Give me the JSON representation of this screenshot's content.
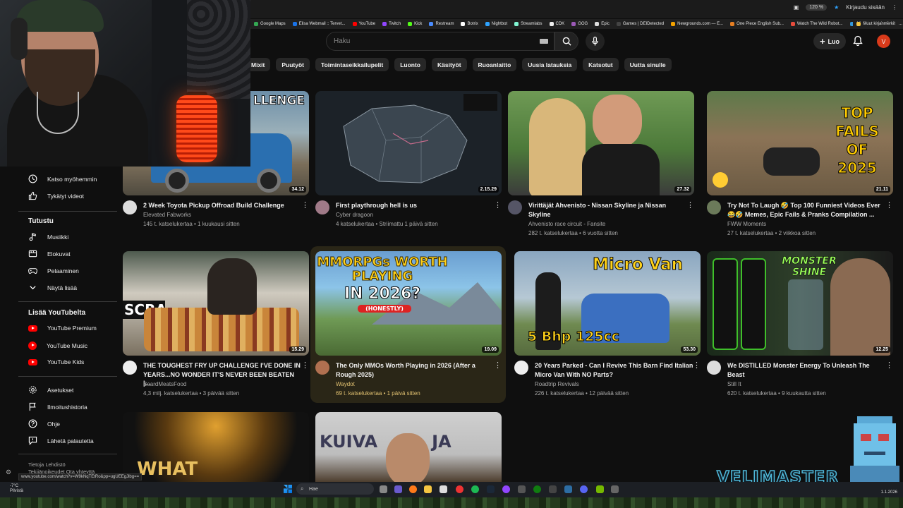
{
  "browser": {
    "zoom": "120 %",
    "profile_label": "Kirjaudu sisään",
    "bookmarks": [
      {
        "label": "Google Maps",
        "color": "#34a853"
      },
      {
        "label": "Elisa Webmail :: Tervet...",
        "color": "#1a73e8"
      },
      {
        "label": "YouTube",
        "color": "#ff0000"
      },
      {
        "label": "Twitch",
        "color": "#9146ff"
      },
      {
        "label": "Kick",
        "color": "#53fc18"
      },
      {
        "label": "Restream",
        "color": "#4a8cff"
      },
      {
        "label": "Botrix",
        "color": "#ffffff"
      },
      {
        "label": "Nightbot",
        "color": "#2ea3ff"
      },
      {
        "label": "Streamlabs",
        "color": "#80f5d2"
      },
      {
        "label": "CDK",
        "color": "#eeeeee"
      },
      {
        "label": "GOG",
        "color": "#9b59b6"
      },
      {
        "label": "Epic",
        "color": "#dddddd"
      },
      {
        "label": "Games | DEIDetected",
        "color": "#444444"
      },
      {
        "label": "Newgrounds.com — E...",
        "color": "#f4a200"
      },
      {
        "label": "One Piece English Sub...",
        "color": "#e67e22"
      },
      {
        "label": "Watch The Wild Robot...",
        "color": "#e74c3c"
      },
      {
        "label": "Aikuisten sosiaalipalve...",
        "color": "#3498db"
      }
    ],
    "more_bookmarks": "Muut kirjanmerkit",
    "status_url": "www.youtube.com/watch?v=W9kNqTEtRo&pp=ugUEEgJlbg=="
  },
  "header": {
    "search_placeholder": "Haku",
    "create_label": "Luo",
    "avatar_letter": "V"
  },
  "chips": [
    "Mixit",
    "Puutyöt",
    "Toimintaseikkailupelit",
    "Luonto",
    "Käsityöt",
    "Ruoanlaitto",
    "Uusia latauksia",
    "Katsotut",
    "Uutta sinulle"
  ],
  "sidebar": {
    "items_top": [
      {
        "label": "Katso myöhemmin",
        "icon": "clock-icon"
      },
      {
        "label": "Tykätyt videot",
        "icon": "thumb-up-icon"
      }
    ],
    "explore_heading": "Tutustu",
    "explore": [
      {
        "label": "Musiikki",
        "icon": "music-note-icon"
      },
      {
        "label": "Elokuvat",
        "icon": "clapperboard-icon"
      },
      {
        "label": "Pelaaminen",
        "icon": "gamepad-icon"
      },
      {
        "label": "Näytä lisää",
        "icon": "chevron-down-icon"
      }
    ],
    "more_heading": "Lisää YouTubelta",
    "more": [
      {
        "label": "YouTube Premium"
      },
      {
        "label": "YouTube Music"
      },
      {
        "label": "YouTube Kids"
      }
    ],
    "settings": [
      {
        "label": "Asetukset",
        "icon": "gear-icon"
      },
      {
        "label": "Ilmoitushistoria",
        "icon": "flag-icon"
      },
      {
        "label": "Ohje",
        "icon": "help-icon"
      },
      {
        "label": "Lähetä palautetta",
        "icon": "feedback-icon"
      }
    ],
    "footer_line1": "Tietoja   Lehdistö",
    "footer_line2": "Tekijänoikeudet   Ota yhteyttä"
  },
  "videos": [
    {
      "title": "2 Week Toyota Pickup Offroad Build Challenge",
      "channel": "Elevated Fabworks",
      "meta": "145 t. katselukertaa • 1 kuukausi sitten",
      "duration": "34.12",
      "overlay": "LLENGE"
    },
    {
      "title": "First playthrough hell is us",
      "channel": "Cyber dragoon",
      "meta": "4 katselukertaa • Striimattu 1 päivä sitten",
      "duration": "2.15.29"
    },
    {
      "title": "Virittäjät Ahvenisto - Nissan Skyline ja Nissan Skyline",
      "channel": "Ahvenisto race circuit - Fansite",
      "meta": "282 t. katselukertaa • 6 vuotta sitten",
      "duration": "27.32"
    },
    {
      "title": "Try Not To Laugh 🤣 Top 100 Funniest Videos Ever 😂🤣 Memes, Epic Fails & Pranks Compilation ...",
      "channel": "FWW Moments",
      "meta": "27 t. katselukertaa • 2 viikkoa sitten",
      "duration": "21.11",
      "overlay": "TOP FAILS OF 2025"
    },
    {
      "title": "THE TOUGHEST FRY UP CHALLENGE I'VE DONE IN YEARS...NO WONDER IT'S NEVER BEEN BEATEN |...",
      "channel": "BeardMeatsFood",
      "meta": "4,3 milj. katselukertaa • 3 päivää sitten",
      "duration": "15.29",
      "overlay": "SCRA"
    },
    {
      "title": "The Only MMOs Worth Playing in 2026 (After a Rough 2025)",
      "channel": "Waydot",
      "meta": "69 t. katselukertaa • 1 päivä sitten",
      "duration": "19.09",
      "overlay1": "MMORPGs WORTH PLAYING",
      "overlay2": "IN 2026?",
      "overlay3": "(HONESTLY)"
    },
    {
      "title": "20 Years Parked - Can I Revive This Barn Find Italian Micro Van With NO Parts?",
      "channel": "Roadtrip Revivals",
      "meta": "226 t. katselukertaa • 12 päivää sitten",
      "duration": "53.30",
      "overlay1": "Micro Van",
      "overlay2": "5 Bhp  125cc"
    },
    {
      "title": "We DISTILLED Monster Energy To Unleash The Beast",
      "channel": "Still It",
      "meta": "620 t. katselukertaa • 9 kuukautta sitten",
      "duration": "12.25",
      "overlay": "MONSTER SHINE"
    }
  ],
  "partial_rows": [
    {
      "overlay": "WHAT"
    },
    {
      "overlay": "KUIVA     A  JA"
    }
  ],
  "taskbar": {
    "weather_temp": "-7°C",
    "weather_desc": "Pilvistä",
    "search_label": "Hae",
    "date": "1.1.2026"
  },
  "branding": "VELIMASTER"
}
